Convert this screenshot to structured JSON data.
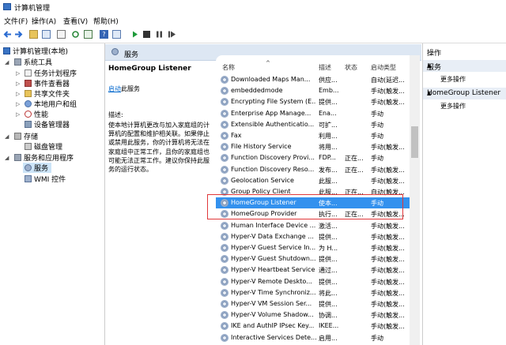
{
  "window": {
    "title": "计算机管理"
  },
  "menu": [
    "文件(F)",
    "操作(A)",
    "查看(V)",
    "帮助(H)"
  ],
  "toolbar": [
    "back-icon",
    "forward-icon",
    "up-icon",
    "show-tree-icon",
    "refresh-icon",
    "export-icon",
    "help-icon",
    "properties-icon",
    "start-icon",
    "stop-icon",
    "pause-icon",
    "restart-icon"
  ],
  "tree": {
    "root": "计算机管理(本地)",
    "system_tools": "系统工具",
    "task_scheduler": "任务计划程序",
    "event_viewer": "事件查看器",
    "shared_folders": "共享文件夹",
    "local_users": "本地用户和组",
    "performance": "性能",
    "device_manager": "设备管理器",
    "storage": "存储",
    "disk_management": "磁盘管理",
    "services_apps": "服务和应用程序",
    "services": "服务",
    "wmi": "WMI 控件"
  },
  "services_header": "服务",
  "detail": {
    "name": "HomeGroup Listener",
    "start_link": "启动",
    "start_suffix": "此服务",
    "desc_label": "描述:",
    "desc": "使本地计算机更改与加入家庭组的计算机的配置和维护相关联。如果停止或禁用此服务，你的计算机将无法在家庭组中正常工作，且你的家庭组也可能无法正常工作。建议你保持此服务的运行状态。"
  },
  "columns": {
    "name": "名称",
    "desc": "描述",
    "status": "状态",
    "startup": "启动类型"
  },
  "rows": [
    {
      "name": "Downloaded Maps Man...",
      "desc": "供应...",
      "status": "",
      "startup": "自动(延迟..."
    },
    {
      "name": "embeddedmode",
      "desc": "Emb...",
      "status": "",
      "startup": "手动(触发..."
    },
    {
      "name": "Encrypting File System (E...",
      "desc": "提供...",
      "status": "",
      "startup": "手动(触发..."
    },
    {
      "name": "Enterprise App Manage...",
      "desc": "Ena...",
      "status": "",
      "startup": "手动"
    },
    {
      "name": "Extensible Authenticatio...",
      "desc": "可扩...",
      "status": "",
      "startup": "手动"
    },
    {
      "name": "Fax",
      "desc": "利用...",
      "status": "",
      "startup": "手动"
    },
    {
      "name": "File History Service",
      "desc": "将用...",
      "status": "",
      "startup": "手动(触发..."
    },
    {
      "name": "Function Discovery Provi...",
      "desc": "FDP...",
      "status": "正在...",
      "startup": "手动"
    },
    {
      "name": "Function Discovery Reso...",
      "desc": "发布...",
      "status": "正在...",
      "startup": "手动(触发..."
    },
    {
      "name": "Geolocation Service",
      "desc": "此服...",
      "status": "",
      "startup": "手动(触发..."
    },
    {
      "name": "Group Policy Client",
      "desc": "此服...",
      "status": "正在...",
      "startup": "自动(触发..."
    },
    {
      "name": "HomeGroup Listener",
      "desc": "使本...",
      "status": "",
      "startup": "手动"
    },
    {
      "name": "HomeGroup Provider",
      "desc": "执行...",
      "status": "正在...",
      "startup": "手动(触发..."
    },
    {
      "name": "Human Interface Device ...",
      "desc": "激活...",
      "status": "",
      "startup": "手动(触发..."
    },
    {
      "name": "Hyper-V Data Exchange ...",
      "desc": "提供...",
      "status": "",
      "startup": "手动(触发..."
    },
    {
      "name": "Hyper-V Guest Service In...",
      "desc": "为 H...",
      "status": "",
      "startup": "手动(触发..."
    },
    {
      "name": "Hyper-V Guest Shutdown...",
      "desc": "提供...",
      "status": "",
      "startup": "手动(触发..."
    },
    {
      "name": "Hyper-V Heartbeat Service",
      "desc": "通过...",
      "status": "",
      "startup": "手动(触发..."
    },
    {
      "name": "Hyper-V Remote Deskto...",
      "desc": "提供...",
      "status": "",
      "startup": "手动(触发..."
    },
    {
      "name": "Hyper-V Time Synchroniz...",
      "desc": "将此...",
      "status": "",
      "startup": "手动(触发..."
    },
    {
      "name": "Hyper-V VM Session Ser...",
      "desc": "提供...",
      "status": "",
      "startup": "手动(触发..."
    },
    {
      "name": "Hyper-V Volume Shadow...",
      "desc": "协调...",
      "status": "",
      "startup": "手动(触发..."
    },
    {
      "name": "IKE and AuthIP IPsec Key...",
      "desc": "IKEE...",
      "status": "",
      "startup": "手动(触发..."
    },
    {
      "name": "Interactive Services Dete...",
      "desc": "启用...",
      "status": "",
      "startup": "手动"
    }
  ],
  "selected_row": "HomeGroup Listener",
  "actions": {
    "header": "操作",
    "section1": "服务",
    "more1": "更多操作",
    "section2": "HomeGroup Listener",
    "more2": "更多操作"
  },
  "colors": {
    "selection": "#3391ee",
    "highlight_box": "#e0383a",
    "header_bg": "#dde7f3"
  }
}
